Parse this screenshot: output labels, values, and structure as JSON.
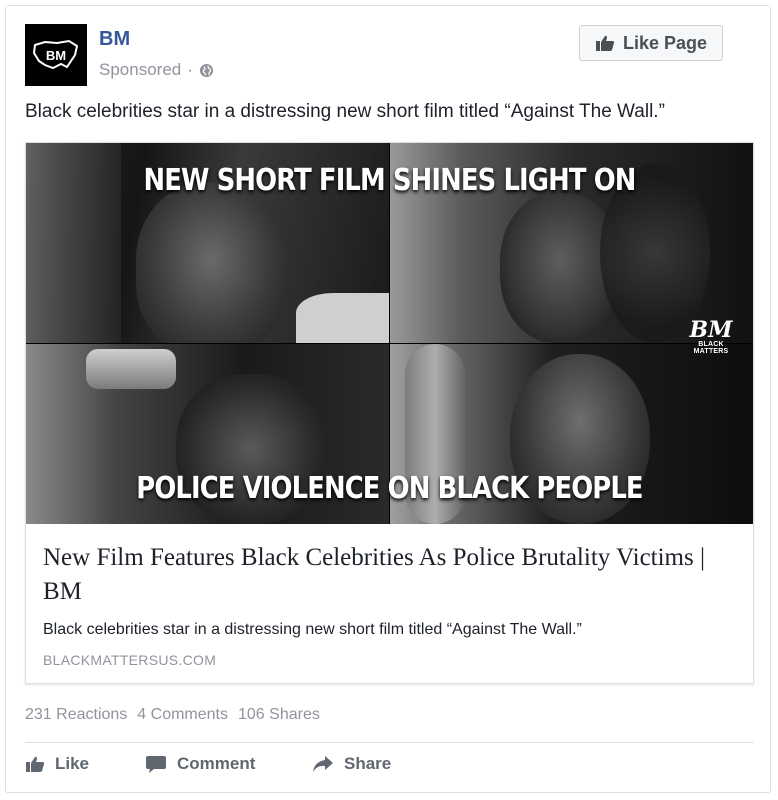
{
  "page": {
    "name": "BM",
    "avatar_text": "BM",
    "sponsored_label": "Sponsored",
    "separator": "·",
    "like_page_label": "Like Page"
  },
  "post": {
    "text": "Black celebrities star in a distressing new short film titled “Against The Wall.”"
  },
  "link_preview": {
    "image": {
      "headline_top": "NEW SHORT FILM SHINES LIGHT ON",
      "headline_bottom": "POLICE VIOLENCE ON BLACK PEOPLE",
      "watermark_logo": "BM",
      "watermark_text": "BLACK MATTERS"
    },
    "title": "New Film Features Black Celebrities As Police Brutality Victims | BM",
    "description": "Black celebrities star in a distressing new short film titled “Against The Wall.”",
    "domain": "BLACKMATTERSUS.COM"
  },
  "stats": {
    "reactions": "231 Reactions",
    "comments": "4 Comments",
    "shares": "106 Shares"
  },
  "actions": {
    "like": "Like",
    "comment": "Comment",
    "share": "Share"
  },
  "colors": {
    "link_blue": "#365899",
    "muted_gray": "#90949c",
    "text": "#1d2129"
  }
}
